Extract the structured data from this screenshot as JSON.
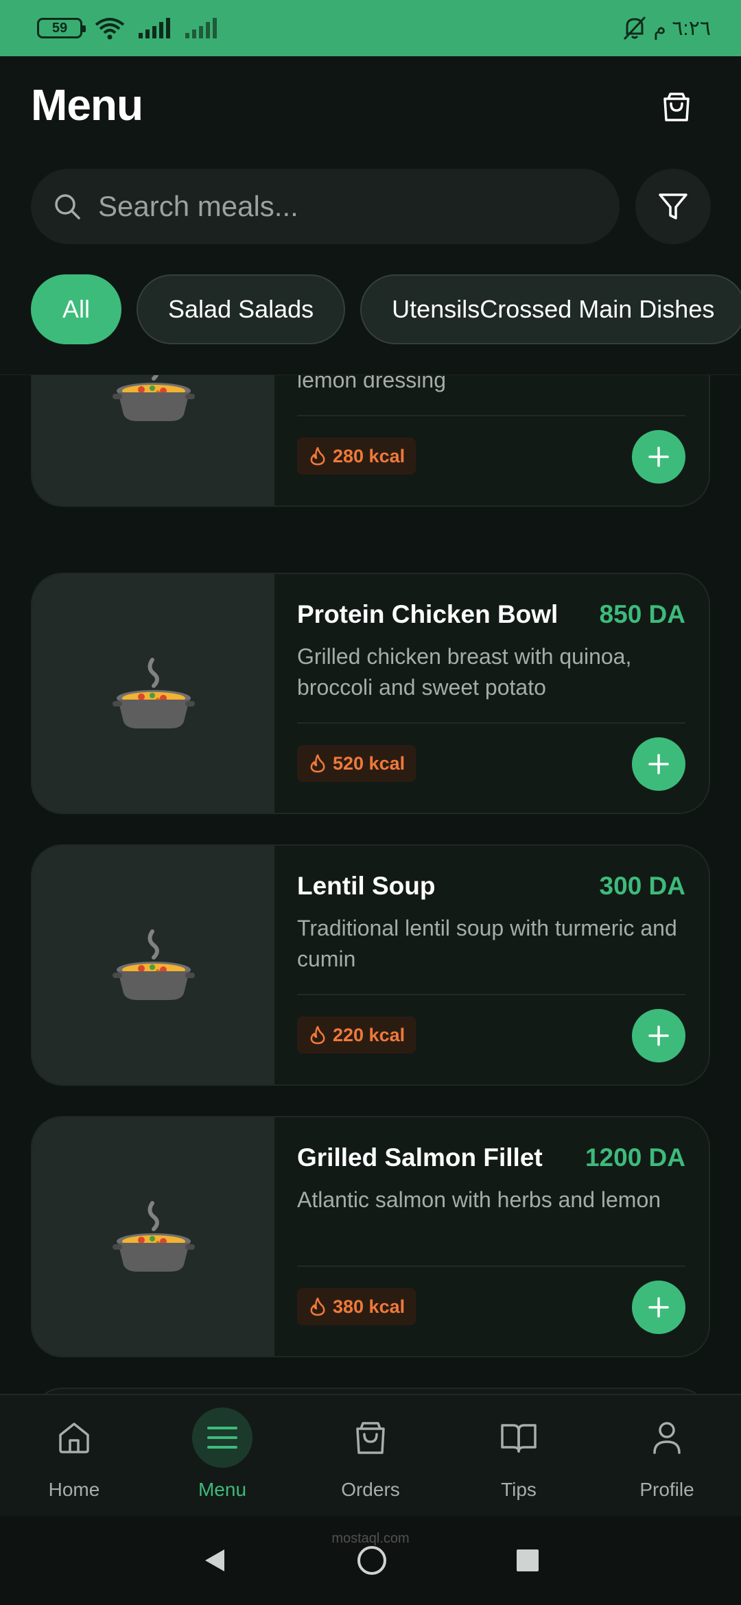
{
  "status_bar": {
    "battery": "59",
    "time": "٦:٢٦ م"
  },
  "header": {
    "title": "Menu"
  },
  "search": {
    "placeholder": "Search meals..."
  },
  "categories": [
    {
      "label": "All",
      "active": true
    },
    {
      "label": "Salad  Salads",
      "active": false
    },
    {
      "label": "UtensilsCrossed  Main Dishes",
      "active": false
    }
  ],
  "meals": [
    {
      "name": "",
      "price": "",
      "description": "Fresh spinach, cucumber, avocado with lemon dressing",
      "kcal": "280 kcal",
      "icon": "soup-pot-emoji"
    },
    {
      "name": "Protein Chicken Bowl",
      "price": "850 DA",
      "description": "Grilled chicken breast with quinoa, broccoli and sweet potato",
      "kcal": "520 kcal",
      "icon": "soup-pot-emoji"
    },
    {
      "name": "Lentil Soup",
      "price": "300 DA",
      "description": "Traditional lentil soup with turmeric and cumin",
      "kcal": "220 kcal",
      "icon": "soup-pot-emoji"
    },
    {
      "name": "Grilled Salmon Fillet",
      "price": "1200 DA",
      "description": "Atlantic salmon with herbs and lemon",
      "kcal": "380 kcal",
      "icon": "soup-pot-emoji"
    }
  ],
  "bottom_nav": [
    {
      "label": "Home",
      "icon": "home-icon",
      "active": false
    },
    {
      "label": "Menu",
      "icon": "menu-icon",
      "active": true
    },
    {
      "label": "Orders",
      "icon": "shopping-bag-icon",
      "active": false
    },
    {
      "label": "Tips",
      "icon": "book-icon",
      "active": false
    },
    {
      "label": "Profile",
      "icon": "user-icon",
      "active": false
    }
  ],
  "watermark": "mostaql.com",
  "colors": {
    "accent": "#3dbb7b",
    "status_bar": "#3aae72",
    "background": "#0d1411",
    "kcal": "#f07a3a"
  }
}
